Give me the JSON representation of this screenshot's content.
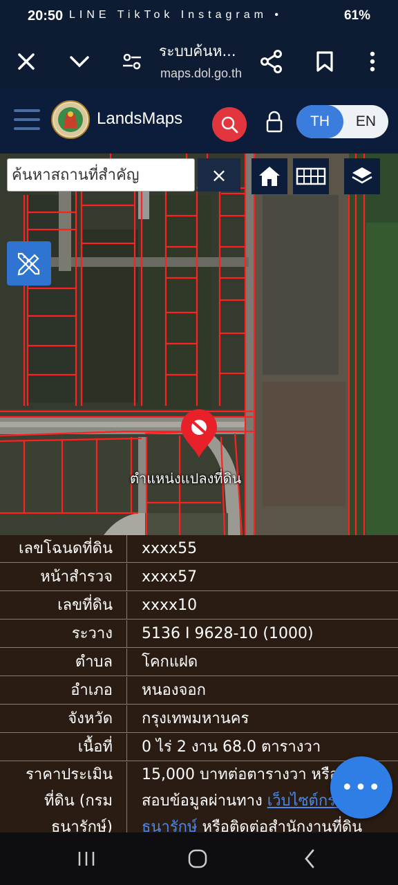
{
  "status_bar": {
    "time": "20:50",
    "app_icons": "LINE TikTok Instagram •",
    "right": "61%"
  },
  "browser": {
    "title": "ระบบค้นห...",
    "url": "maps.dol.go.th"
  },
  "header": {
    "brand": "LandsMaps",
    "lang_th": "TH",
    "lang_en": "EN"
  },
  "map": {
    "search_placeholder": "ค้นหาสถานที่สำคัญ",
    "clear_label": "×",
    "marker_label": "ตำแหน่งแปลงที่ดิน"
  },
  "parcel_info": [
    {
      "label": "เลขโฉนดที่ดิน",
      "value": "xxxx55"
    },
    {
      "label": "หน้าสำรวจ",
      "value": "xxxx57"
    },
    {
      "label": "เลขที่ดิน",
      "value": "xxxx10"
    },
    {
      "label": "ระวาง",
      "value": "5136 I 9628-10 (1000)"
    },
    {
      "label": "ตำบล",
      "value": "โคกแฝด"
    },
    {
      "label": "อำเภอ",
      "value": "หนองจอก"
    },
    {
      "label": "จังหวัด",
      "value": "กรุงเทพมหานคร"
    },
    {
      "label": "เนื้อที่",
      "value": "0 ไร่ 2 งาน 68.0 ตารางวา"
    }
  ],
  "price": {
    "label_line1": "ราคาประเมิน",
    "label_line2": "ที่ดิน (กรม",
    "label_line3": "ธนารักษ์)",
    "line1": "15,000 บาทต่อตารางวา หรือตรวจ",
    "line2_text": "สอบข้อมูลผ่านทาง ",
    "line2_link": "เว็บไซต์กรม",
    "line3_link": "ธนารักษ์",
    "line3_text": " หรือติดต่อสำนักงานที่ดิน"
  },
  "fab_label": "•••",
  "colors": {
    "header_bg": "#0c1d3b",
    "search_red": "#e2353d",
    "accent_blue": "#3b7ddd",
    "info_bg": "#2a1c12",
    "parcel_lines": "#ff2020"
  }
}
